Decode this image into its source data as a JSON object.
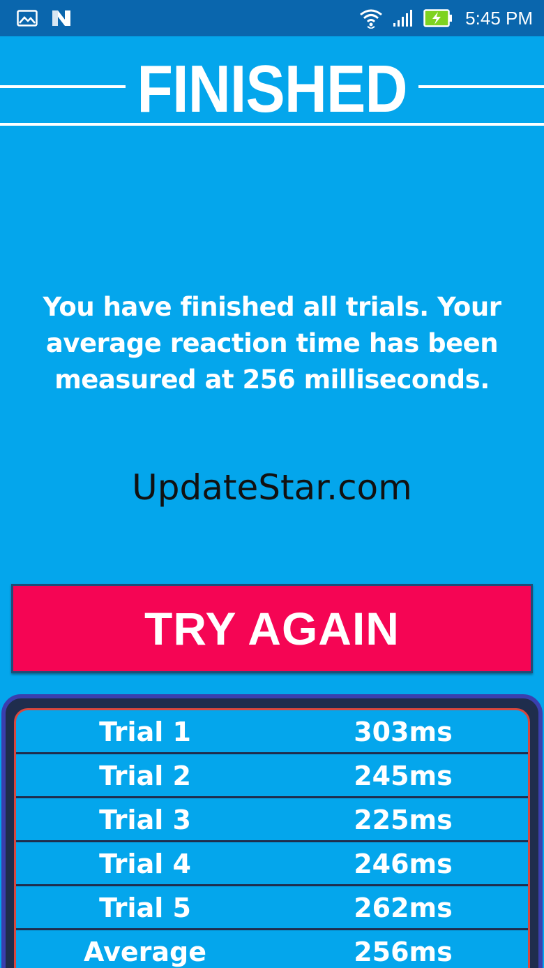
{
  "status_bar": {
    "time": "5:45 PM",
    "icons": [
      "gallery-icon",
      "n-app-icon",
      "wifi-icon",
      "signal-icon",
      "battery-charging-icon"
    ],
    "colors": {
      "background": "#0a66ad",
      "battery": "#7ed321"
    }
  },
  "header": {
    "title": "FINISHED"
  },
  "message": {
    "text": "You have finished all trials. Your average reaction time has been measured at 256 milliseconds."
  },
  "watermark": {
    "text": "UpdateStar.com"
  },
  "try_again": {
    "label": "TRY AGAIN",
    "color": "#f50554"
  },
  "results": {
    "rows": [
      {
        "label": "Trial 1",
        "value": "303ms"
      },
      {
        "label": "Trial 2",
        "value": "245ms"
      },
      {
        "label": "Trial 3",
        "value": "225ms"
      },
      {
        "label": "Trial 4",
        "value": "246ms"
      },
      {
        "label": "Trial 5",
        "value": "262ms"
      },
      {
        "label": "Average",
        "value": "256ms"
      }
    ]
  },
  "colors": {
    "background": "#04a6ec",
    "table_border": "#3a3fae",
    "table_inner_border": "#d9473d"
  }
}
